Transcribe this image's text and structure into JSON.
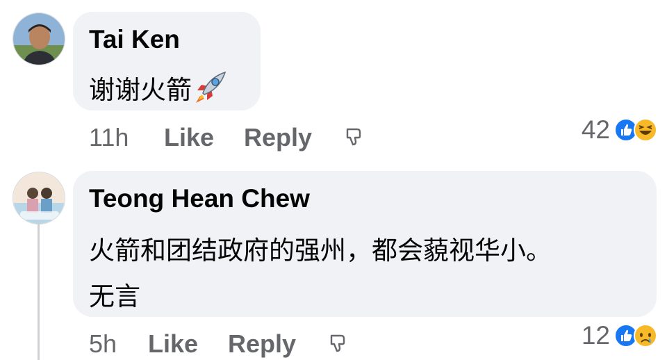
{
  "comments": [
    {
      "author": "Tai Ken",
      "text": "谢谢火箭",
      "emoji_icon": "rocket-emoji",
      "time": "11h",
      "like_label": "Like",
      "reply_label": "Reply",
      "reaction_count": "42",
      "reactions": [
        "like",
        "haha"
      ]
    },
    {
      "author": "Teong Hean Chew",
      "text_line1": "火箭和团结政府的强州，都会藐视华小。",
      "text_line2": "无言",
      "time": "5h",
      "like_label": "Like",
      "reply_label": "Reply",
      "reaction_count": "12",
      "reactions": [
        "like",
        "sad"
      ]
    }
  ],
  "colors": {
    "bubble": "#f0f2f5",
    "text": "#050505",
    "meta": "#65676b",
    "like_blue": "#1877f2",
    "emoji_yellow": "#f7b928"
  }
}
